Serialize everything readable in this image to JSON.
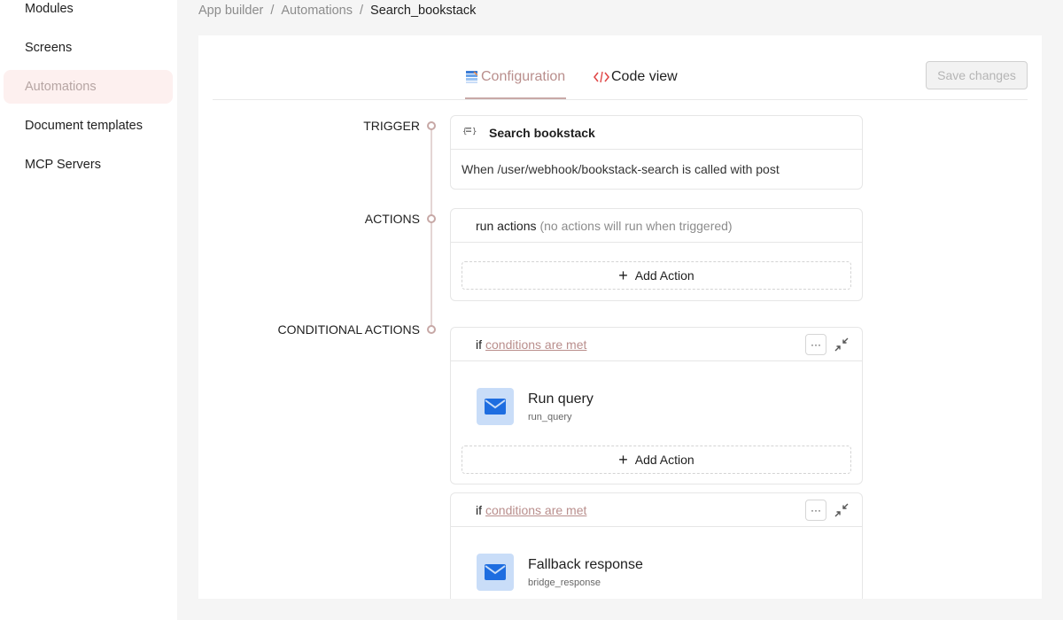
{
  "sidebar": {
    "items": [
      {
        "label": "Modules"
      },
      {
        "label": "Screens"
      },
      {
        "label": "Automations"
      },
      {
        "label": "Document templates"
      },
      {
        "label": "MCP Servers"
      }
    ]
  },
  "breadcrumb": {
    "items": [
      "App builder",
      "Automations",
      "Search_bookstack"
    ]
  },
  "tabs": {
    "configuration": "Configuration",
    "code_view": "Code view"
  },
  "save_button": "Save changes",
  "sections": {
    "trigger": "TRIGGER",
    "actions": "ACTIONS",
    "conditional": "CONDITIONAL ACTIONS"
  },
  "trigger_card": {
    "title": "Search bookstack",
    "description": "When /user/webhook/bookstack-search is called with post"
  },
  "actions_card": {
    "title": "run actions",
    "note": "(no actions will run when triggered)",
    "add_label": "Add Action"
  },
  "conditional_cards": [
    {
      "if_label": "if",
      "condition_link": "conditions are met",
      "step_title": "Run query",
      "step_sub": "run_query",
      "add_label": "Add Action"
    },
    {
      "if_label": "if",
      "condition_link": "conditions are met",
      "step_title": "Fallback response",
      "step_sub": "bridge_response"
    }
  ],
  "more_button": "···",
  "colors": {
    "accent": "#b98e8c",
    "active_bg": "#fdf0ef",
    "step_icon_bg": "#c9ddf8",
    "step_icon_fg": "#1e6de0"
  }
}
